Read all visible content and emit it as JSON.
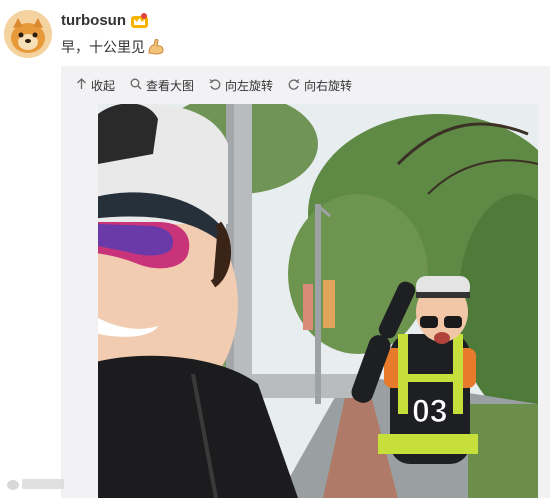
{
  "post": {
    "username": "turbosun",
    "text": "早，十公里见"
  },
  "toolbar": {
    "collapse_label": "收起",
    "view_large_label": "查看大图",
    "rotate_left_label": "向左旋转",
    "rotate_right_label": "向右旋转"
  },
  "icons": {
    "collapse": "arrow-up-icon",
    "view_large": "magnifier-icon",
    "rotate_left": "rotate-left-icon",
    "rotate_right": "rotate-right-icon",
    "badge": "crown-badge-icon",
    "emoji": "flexed-bicep-icon"
  },
  "colors": {
    "toolbar_bg": "#f2f2f5",
    "text": "#333333",
    "tree_green": "#4e7a3a",
    "sky": "#e6ecf0"
  }
}
